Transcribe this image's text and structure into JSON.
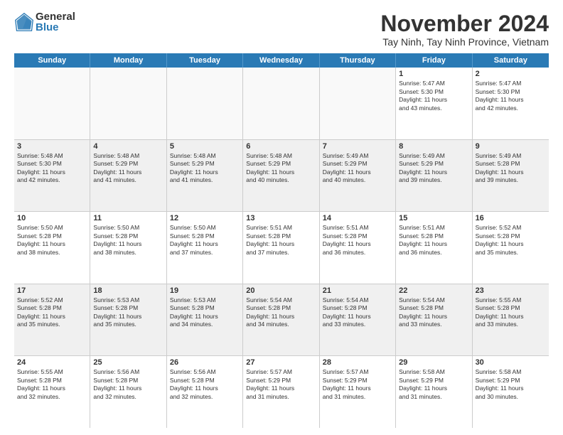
{
  "logo": {
    "general": "General",
    "blue": "Blue"
  },
  "title": "November 2024",
  "location": "Tay Ninh, Tay Ninh Province, Vietnam",
  "header": {
    "days": [
      "Sunday",
      "Monday",
      "Tuesday",
      "Wednesday",
      "Thursday",
      "Friday",
      "Saturday"
    ]
  },
  "weeks": [
    [
      {
        "day": "",
        "info": "",
        "empty": true
      },
      {
        "day": "",
        "info": "",
        "empty": true
      },
      {
        "day": "",
        "info": "",
        "empty": true
      },
      {
        "day": "",
        "info": "",
        "empty": true
      },
      {
        "day": "",
        "info": "",
        "empty": true
      },
      {
        "day": "1",
        "info": "Sunrise: 5:47 AM\nSunset: 5:30 PM\nDaylight: 11 hours\nand 43 minutes."
      },
      {
        "day": "2",
        "info": "Sunrise: 5:47 AM\nSunset: 5:30 PM\nDaylight: 11 hours\nand 42 minutes."
      }
    ],
    [
      {
        "day": "3",
        "info": "Sunrise: 5:48 AM\nSunset: 5:30 PM\nDaylight: 11 hours\nand 42 minutes."
      },
      {
        "day": "4",
        "info": "Sunrise: 5:48 AM\nSunset: 5:29 PM\nDaylight: 11 hours\nand 41 minutes."
      },
      {
        "day": "5",
        "info": "Sunrise: 5:48 AM\nSunset: 5:29 PM\nDaylight: 11 hours\nand 41 minutes."
      },
      {
        "day": "6",
        "info": "Sunrise: 5:48 AM\nSunset: 5:29 PM\nDaylight: 11 hours\nand 40 minutes."
      },
      {
        "day": "7",
        "info": "Sunrise: 5:49 AM\nSunset: 5:29 PM\nDaylight: 11 hours\nand 40 minutes."
      },
      {
        "day": "8",
        "info": "Sunrise: 5:49 AM\nSunset: 5:29 PM\nDaylight: 11 hours\nand 39 minutes."
      },
      {
        "day": "9",
        "info": "Sunrise: 5:49 AM\nSunset: 5:28 PM\nDaylight: 11 hours\nand 39 minutes."
      }
    ],
    [
      {
        "day": "10",
        "info": "Sunrise: 5:50 AM\nSunset: 5:28 PM\nDaylight: 11 hours\nand 38 minutes."
      },
      {
        "day": "11",
        "info": "Sunrise: 5:50 AM\nSunset: 5:28 PM\nDaylight: 11 hours\nand 38 minutes."
      },
      {
        "day": "12",
        "info": "Sunrise: 5:50 AM\nSunset: 5:28 PM\nDaylight: 11 hours\nand 37 minutes."
      },
      {
        "day": "13",
        "info": "Sunrise: 5:51 AM\nSunset: 5:28 PM\nDaylight: 11 hours\nand 37 minutes."
      },
      {
        "day": "14",
        "info": "Sunrise: 5:51 AM\nSunset: 5:28 PM\nDaylight: 11 hours\nand 36 minutes."
      },
      {
        "day": "15",
        "info": "Sunrise: 5:51 AM\nSunset: 5:28 PM\nDaylight: 11 hours\nand 36 minutes."
      },
      {
        "day": "16",
        "info": "Sunrise: 5:52 AM\nSunset: 5:28 PM\nDaylight: 11 hours\nand 35 minutes."
      }
    ],
    [
      {
        "day": "17",
        "info": "Sunrise: 5:52 AM\nSunset: 5:28 PM\nDaylight: 11 hours\nand 35 minutes."
      },
      {
        "day": "18",
        "info": "Sunrise: 5:53 AM\nSunset: 5:28 PM\nDaylight: 11 hours\nand 35 minutes."
      },
      {
        "day": "19",
        "info": "Sunrise: 5:53 AM\nSunset: 5:28 PM\nDaylight: 11 hours\nand 34 minutes."
      },
      {
        "day": "20",
        "info": "Sunrise: 5:54 AM\nSunset: 5:28 PM\nDaylight: 11 hours\nand 34 minutes."
      },
      {
        "day": "21",
        "info": "Sunrise: 5:54 AM\nSunset: 5:28 PM\nDaylight: 11 hours\nand 33 minutes."
      },
      {
        "day": "22",
        "info": "Sunrise: 5:54 AM\nSunset: 5:28 PM\nDaylight: 11 hours\nand 33 minutes."
      },
      {
        "day": "23",
        "info": "Sunrise: 5:55 AM\nSunset: 5:28 PM\nDaylight: 11 hours\nand 33 minutes."
      }
    ],
    [
      {
        "day": "24",
        "info": "Sunrise: 5:55 AM\nSunset: 5:28 PM\nDaylight: 11 hours\nand 32 minutes."
      },
      {
        "day": "25",
        "info": "Sunrise: 5:56 AM\nSunset: 5:28 PM\nDaylight: 11 hours\nand 32 minutes."
      },
      {
        "day": "26",
        "info": "Sunrise: 5:56 AM\nSunset: 5:28 PM\nDaylight: 11 hours\nand 32 minutes."
      },
      {
        "day": "27",
        "info": "Sunrise: 5:57 AM\nSunset: 5:29 PM\nDaylight: 11 hours\nand 31 minutes."
      },
      {
        "day": "28",
        "info": "Sunrise: 5:57 AM\nSunset: 5:29 PM\nDaylight: 11 hours\nand 31 minutes."
      },
      {
        "day": "29",
        "info": "Sunrise: 5:58 AM\nSunset: 5:29 PM\nDaylight: 11 hours\nand 31 minutes."
      },
      {
        "day": "30",
        "info": "Sunrise: 5:58 AM\nSunset: 5:29 PM\nDaylight: 11 hours\nand 30 minutes."
      }
    ]
  ]
}
